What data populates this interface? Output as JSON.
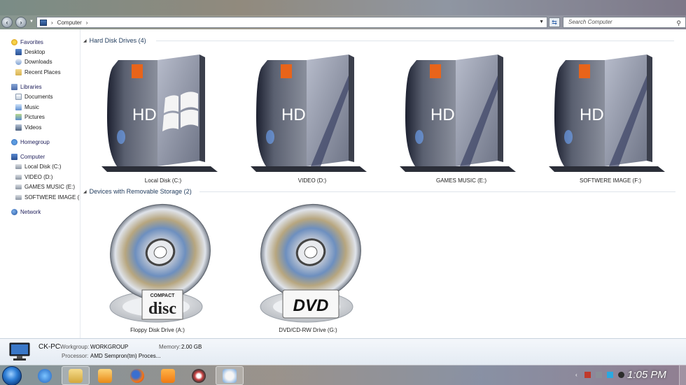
{
  "address": {
    "path": [
      "Computer"
    ],
    "search_placeholder": "Search Computer"
  },
  "sidebar": {
    "groups": [
      {
        "label": "Favorites",
        "items": [
          "Desktop",
          "Downloads",
          "Recent Places"
        ]
      },
      {
        "label": "Libraries",
        "items": [
          "Documents",
          "Music",
          "Pictures",
          "Videos"
        ]
      },
      {
        "label": "Homegroup",
        "items": []
      },
      {
        "label": "Computer",
        "items": [
          "Local Disk (C:)",
          "VIDEO (D:)",
          "GAMES MUSIC (E:)",
          "SOFTWERE IMAGE (F:"
        ]
      },
      {
        "label": "Network",
        "items": []
      }
    ]
  },
  "content": {
    "groups": [
      {
        "title": "Hard Disk Drives (4)",
        "items": [
          "Local Disk (C:)",
          "VIDEO (D:)",
          "GAMES MUSIC (E:)",
          "SOFTWERE IMAGE (F:)"
        ]
      },
      {
        "title": "Devices with Removable Storage (2)",
        "items": [
          "Floppy Disk Drive (A:)",
          "DVD/CD-RW Drive (G:)"
        ]
      }
    ],
    "art_text": {
      "hd": "HD",
      "disc_top": "COMPACT",
      "disc_main": "disc",
      "dvd": "DVD"
    }
  },
  "details": {
    "pc_name": "CK-PC",
    "workgroup_label": "Workgroup:",
    "workgroup": "WORKGROUP",
    "memory_label": "Memory:",
    "memory": "2.00 GB",
    "processor_label": "Processor:",
    "processor": "AMD Sempron(tm) Proces..."
  },
  "taskbar": {
    "apps": [
      "internet-explorer",
      "explorer",
      "media-player",
      "firefox",
      "uc-browser",
      "app-circle",
      "paint"
    ],
    "clock": "1:05 PM"
  },
  "colors": {
    "accent": "#2a5ea8",
    "drive_tag": "#e8641a"
  }
}
